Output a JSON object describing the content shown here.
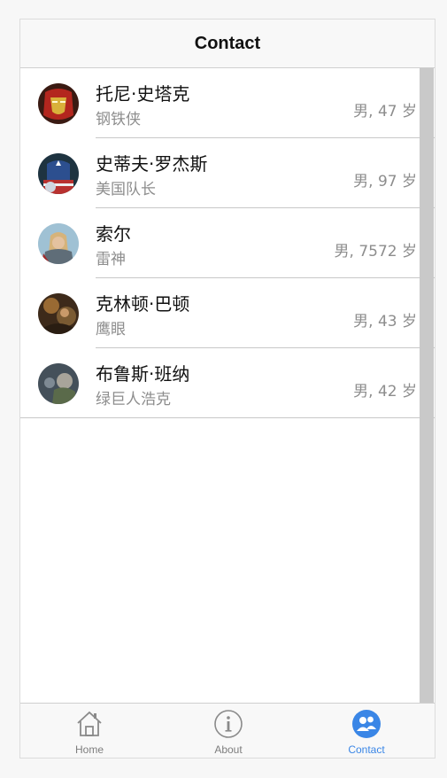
{
  "header": {
    "title": "Contact"
  },
  "contacts": [
    {
      "name": "托尼·史塔克",
      "alias": "钢铁侠",
      "meta": "男, 47 岁",
      "avatar": "iron-man"
    },
    {
      "name": "史蒂夫·罗杰斯",
      "alias": "美国队长",
      "meta": "男, 97 岁",
      "avatar": "captain-america"
    },
    {
      "name": "索尔",
      "alias": "雷神",
      "meta": "男, 7572 岁",
      "avatar": "thor"
    },
    {
      "name": "克林顿·巴顿",
      "alias": "鹰眼",
      "meta": "男, 43 岁",
      "avatar": "hawkeye"
    },
    {
      "name": "布鲁斯·班纳",
      "alias": "绿巨人浩克",
      "meta": "男, 42 岁",
      "avatar": "hulk"
    }
  ],
  "tabs": [
    {
      "label": "Home",
      "icon": "home-icon",
      "active": false
    },
    {
      "label": "About",
      "icon": "info-icon",
      "active": false
    },
    {
      "label": "Contact",
      "icon": "contacts-icon",
      "active": true
    }
  ],
  "colors": {
    "accent": "#3a86e6",
    "muted": "#8d8d8d",
    "divider": "#c8c8c8"
  }
}
